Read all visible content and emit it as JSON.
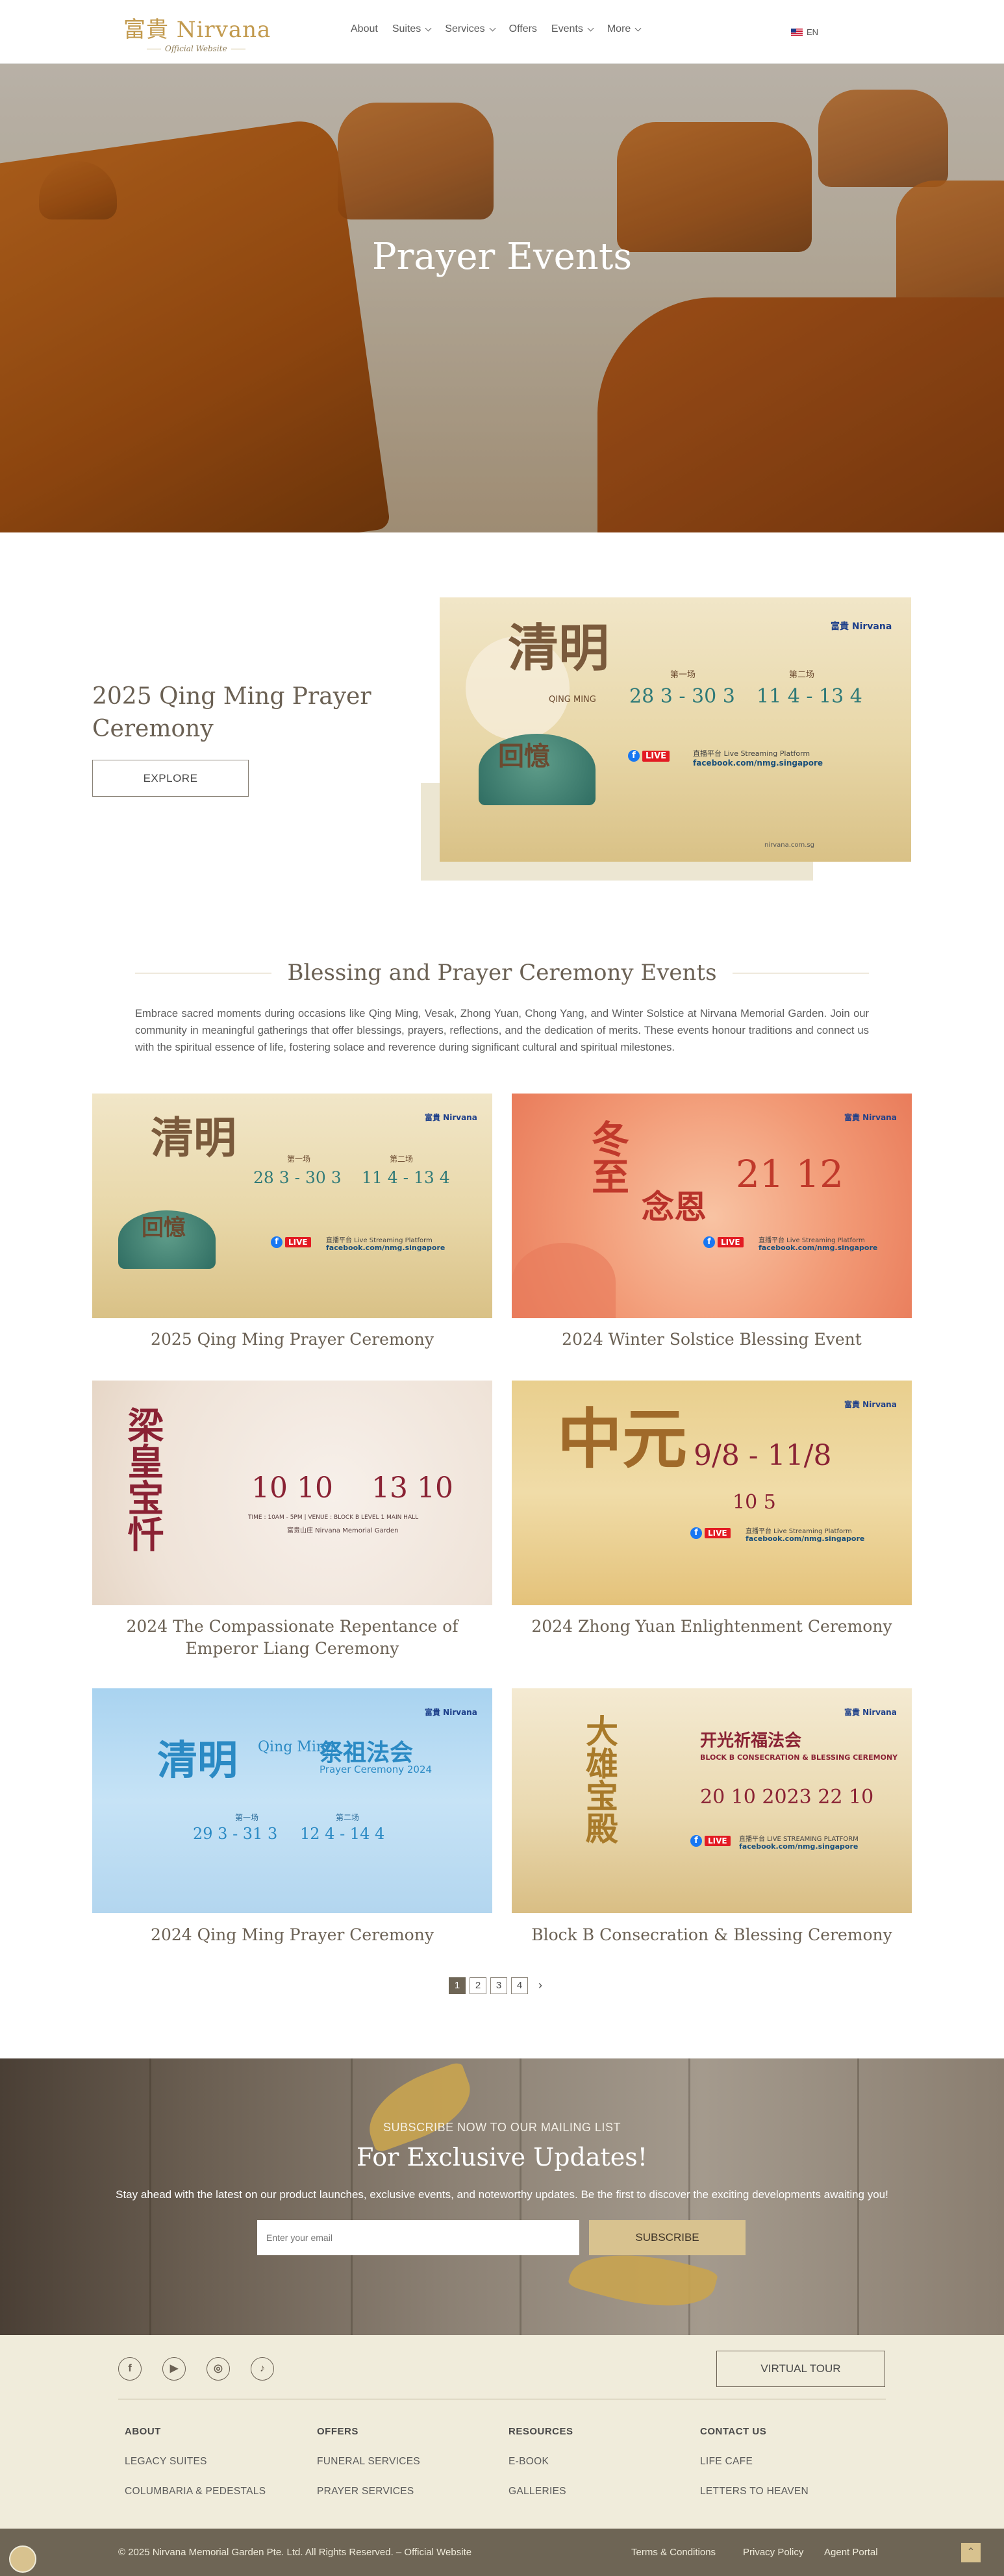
{
  "header": {
    "logo_text": "富貴 Nirvana",
    "logo_sub": "Official Website",
    "nav": [
      "About",
      "Suites",
      "Services",
      "Offers",
      "Events",
      "More"
    ],
    "lang": "EN"
  },
  "hero": {
    "title": "Prayer Events"
  },
  "featured": {
    "title": "2025 Qing Ming Prayer Ceremony",
    "button": "EXPLORE"
  },
  "posters": {
    "qm2025": {
      "big": "清明",
      "big2": "回憶",
      "roman": "QING MING",
      "s1": "第一场",
      "s2": "第二场",
      "d1": "28 3 - 30 3",
      "d2": "11 4 - 13 4",
      "stream": "直播平台 Live Streaming Platform",
      "fbpage": "facebook.com/nmg.singapore",
      "live": "LIVE"
    },
    "winter": {
      "big": "冬至",
      "big2": "念恩",
      "date": "21 12",
      "stream": "直播平台 Live Streaming Platform",
      "fbpage": "facebook.com/nmg.singapore",
      "live": "LIVE"
    },
    "liang": {
      "big": "梁皇宝忏",
      "d1": "10 10",
      "d2": "13 10",
      "line": "TIME : 10AM - 5PM | VENUE : BLOCK B LEVEL 1 MAIN HALL",
      "sub": "富贵山庄 Nirvana Memorial Garden"
    },
    "zhongyuan": {
      "big": "中元",
      "d": "9/8 - 11/8",
      "d2": "10 5",
      "stream": "直播平台 Live Streaming Platform",
      "fbpage": "facebook.com/nmg.singapore",
      "live": "LIVE"
    },
    "qm2024": {
      "big": "清明",
      "mid": "祭祖法会",
      "en1": "Qing Ming",
      "en2": "Prayer Ceremony 2024",
      "s1": "第一场",
      "s2": "第二场",
      "d1": "29 3 - 31 3",
      "d2": "12 4 - 14 4"
    },
    "blockb": {
      "big": "大雄宝殿",
      "t1": "开光祈福法会",
      "t2": "BLOCK B CONSECRATION & BLESSING CEREMONY",
      "d": "20 10  2023  22 10",
      "stream": "直播平台 LIVE STREAMING PLATFORM",
      "fbpage": "facebook.com/nmg.singapore",
      "live": "LIVE"
    },
    "brand": "富貴 Nirvana",
    "site": "nirvana.com.sg"
  },
  "section": {
    "title": "Blessing and Prayer Ceremony Events",
    "description": "Embrace sacred moments during occasions like Qing Ming, Vesak, Zhong Yuan, Chong Yang, and Winter Solstice at Nirvana Memorial Garden. Join our community in meaningful gatherings that offer blessings, prayers, reflections, and the dedication of merits. These events honour traditions and connect us with the spiritual essence of life, fostering solace and reverence during significant cultural and spiritual milestones."
  },
  "cards": [
    {
      "title": "2025 Qing Ming Prayer Ceremony"
    },
    {
      "title": "2024 Winter Solstice Blessing Event"
    },
    {
      "title": "2024 The Compassionate Repentance of Emperor Liang Ceremony"
    },
    {
      "title": "2024 Zhong Yuan Enlightenment Ceremony"
    },
    {
      "title": "2024 Qing Ming Prayer Ceremony"
    },
    {
      "title": "Block B Consecration & Blessing Ceremony"
    }
  ],
  "pagination": {
    "pages": [
      "1",
      "2",
      "3",
      "4"
    ],
    "next": "›"
  },
  "subscribe": {
    "kicker": "SUBSCRIBE NOW TO OUR MAILING LIST",
    "title": "For Exclusive Updates!",
    "description": "Stay ahead with the latest on our product launches, exclusive events, and noteworthy updates. Be the first to discover the exciting developments awaiting you!",
    "placeholder": "Enter your email",
    "button": "SUBSCRIBE"
  },
  "footer": {
    "virtual_tour": "VIRTUAL TOUR",
    "columns": [
      {
        "heading": "ABOUT",
        "links": [
          "LEGACY SUITES",
          "COLUMBARIA & PEDESTALS"
        ]
      },
      {
        "heading": "OFFERS",
        "links": [
          "FUNERAL SERVICES",
          "PRAYER SERVICES"
        ]
      },
      {
        "heading": "RESOURCES",
        "links": [
          "E-BOOK",
          "GALLERIES"
        ]
      },
      {
        "heading": "CONTACT US",
        "links": [
          "LIFE CAFE",
          "LETTERS TO HEAVEN"
        ]
      }
    ],
    "copyright": "© 2025 Nirvana Memorial Garden Pte. Ltd. All Rights Reserved. – Official Website",
    "legal": [
      "Terms & Conditions",
      "Privacy Policy",
      "Agent Portal"
    ]
  }
}
